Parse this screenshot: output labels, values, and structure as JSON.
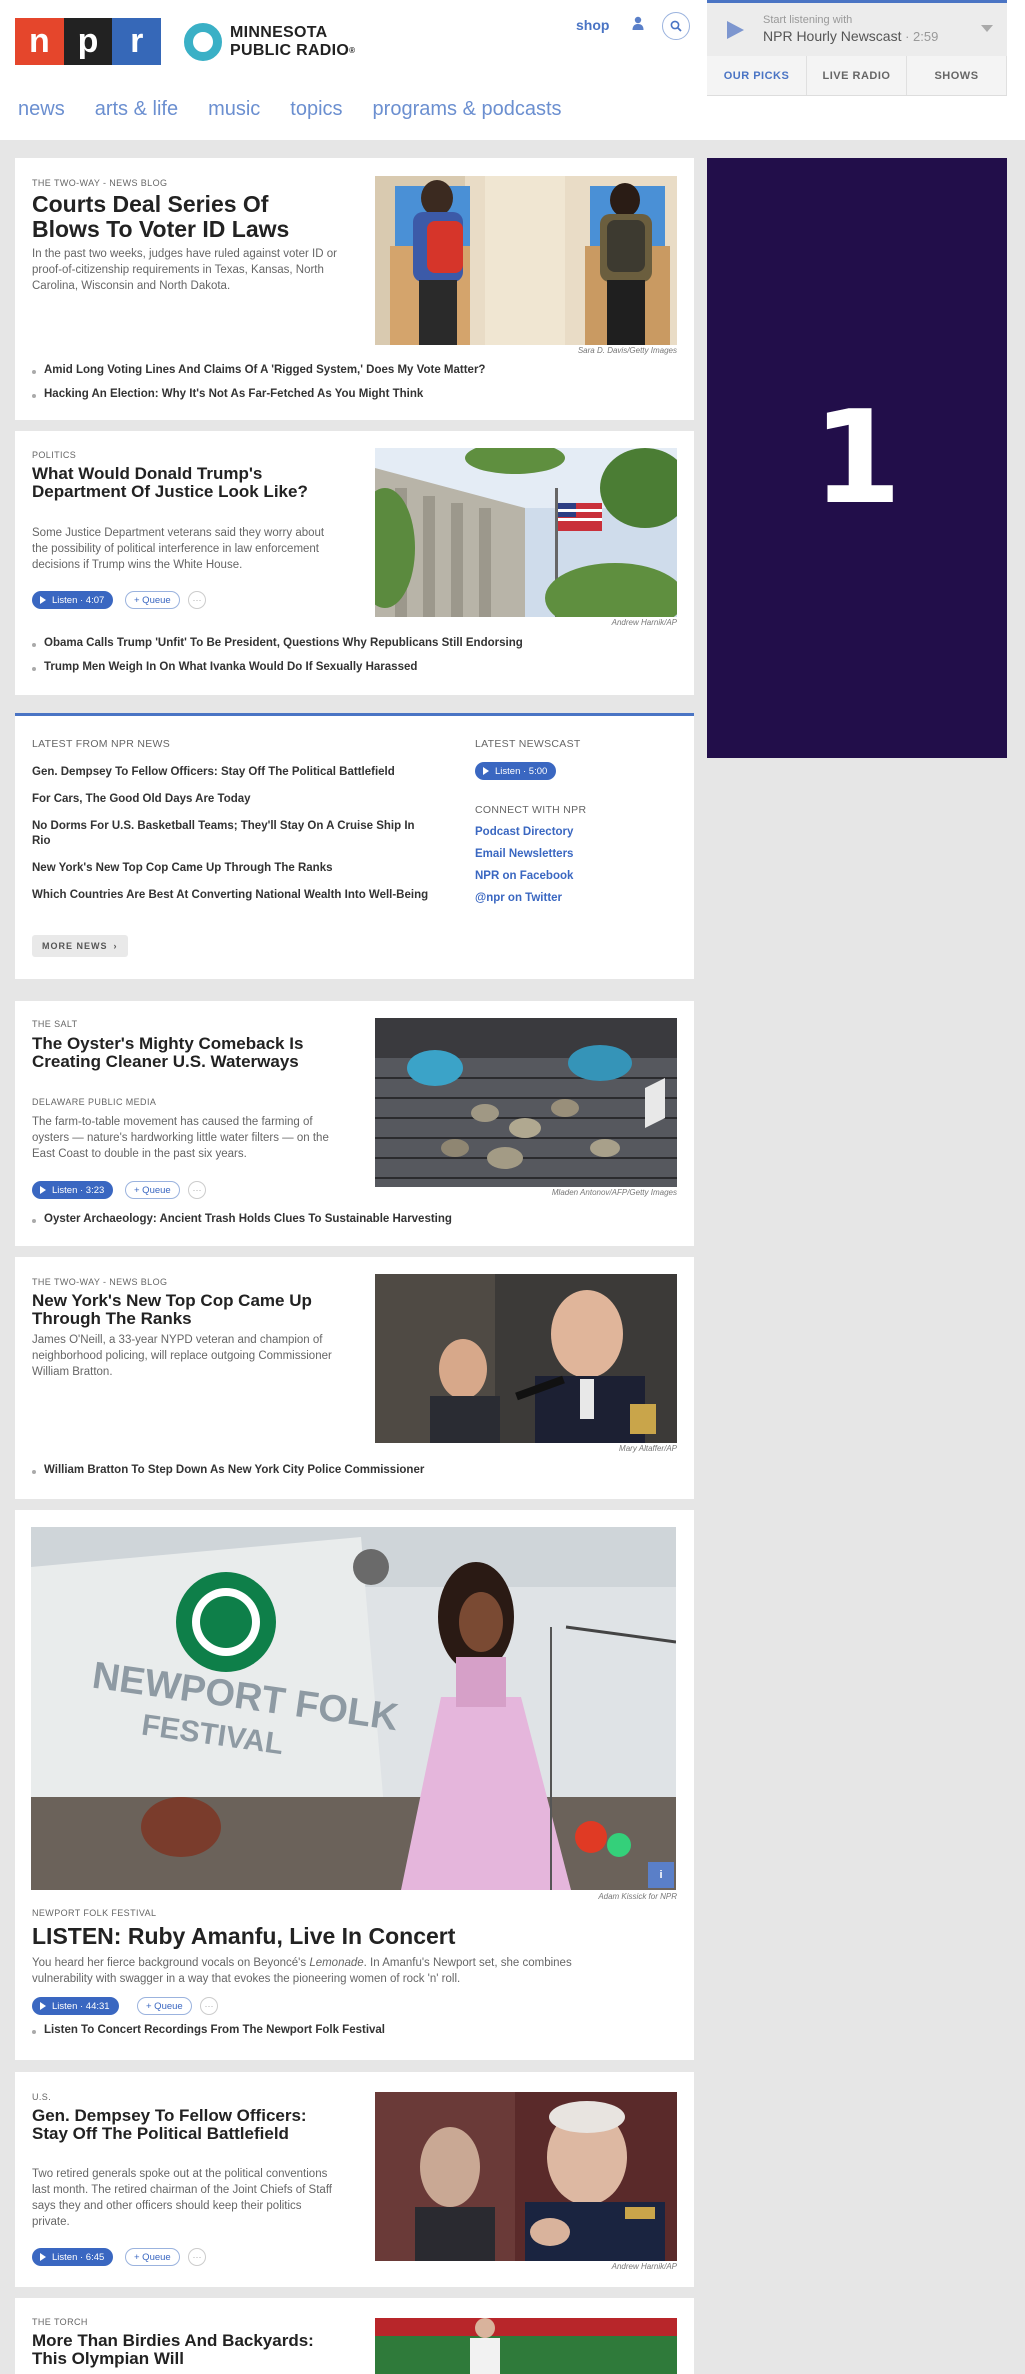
{
  "header": {
    "npr_letters": [
      "n",
      "p",
      "r"
    ],
    "station_line1": "MINNESOTA",
    "station_line2": "PUBLIC RADIO",
    "station_mark": "®",
    "shop": "shop",
    "user_icon": "user-icon",
    "search_icon": "search-icon"
  },
  "player": {
    "start": "Start listening with",
    "program": "NPR Hourly Newscast",
    "duration": " · 2:59",
    "tabs": [
      "OUR PICKS",
      "LIVE RADIO",
      "SHOWS"
    ]
  },
  "nav": [
    "news",
    "arts & life",
    "music",
    "topics",
    "programs & podcasts"
  ],
  "ad": {
    "text": "1"
  },
  "stories": [
    {
      "slug": "THE TWO-WAY - NEWS BLOG",
      "title": "Courts Deal Series Of Blows To Voter ID Laws",
      "teaser": "In the past two weeks, judges have ruled against voter ID or proof-of-citizenship requirements in Texas, Kansas, North Carolina, Wisconsin and North Dakota.",
      "credit": "Sara D. Davis/Getty Images",
      "related": [
        "Amid Long Voting Lines And Claims Of A 'Rigged System,' Does My Vote Matter?",
        "Hacking An Election: Why It's Not As Far-Fetched As You Might Think"
      ]
    },
    {
      "slug": "POLITICS",
      "title": "What Would Donald Trump's Department Of Justice Look Like?",
      "teaser": "Some Justice Department veterans said they worry about the possibility of political interference in law enforcement decisions if Trump wins the White House.",
      "listen": "Listen · 4:07",
      "queue": "+ Queue",
      "credit": "Andrew Harnik/AP",
      "related": [
        "Obama Calls Trump 'Unfit' To Be President, Questions Why Republicans Still Endorsing",
        "Trump Men Weigh In On What Ivanka Would Do If Sexually Harassed"
      ]
    },
    {
      "slug": "THE SALT",
      "title": "The Oyster's Mighty Comeback Is Creating Cleaner U.S. Waterways",
      "source": "DELAWARE PUBLIC MEDIA",
      "teaser": "The farm-to-table movement has caused the farming of oysters — nature's hardworking little water filters — on the East Coast to double in the past six years.",
      "listen": "Listen · 3:23",
      "queue": "+ Queue",
      "credit": "Mladen Antonov/AFP/Getty Images",
      "related": [
        "Oyster Archaeology: Ancient Trash Holds Clues To Sustainable Harvesting"
      ]
    },
    {
      "slug": "THE TWO-WAY - NEWS BLOG",
      "title": "New York's New Top Cop Came Up Through The Ranks",
      "teaser": "James O'Neill, a 33-year NYPD veteran and champion of neighborhood policing, will replace outgoing Commissioner William Bratton.",
      "credit": "Mary Altaffer/AP",
      "related": [
        "William Bratton To Step Down As New York City Police Commissioner"
      ]
    },
    {
      "slug": "NEWPORT FOLK FESTIVAL",
      "title": "LISTEN: Ruby Amanfu, Live In Concert",
      "teaser_pre": "You heard her fierce background vocals on Beyoncé's ",
      "teaser_em": "Lemonade",
      "teaser_post": ". In Amanfu's Newport set, she combines vulnerability with swagger in a way that evokes the pioneering women of rock 'n' roll.",
      "listen": "Listen · 44:31",
      "queue": "+ Queue",
      "credit": "Adam Kissick for NPR",
      "banner_line1": "NEWPORT FOLK",
      "banner_line2": "FESTIVAL",
      "info_icon": "i",
      "related": [
        "Listen To Concert Recordings From The Newport Folk Festival"
      ]
    },
    {
      "slug": "U.S.",
      "title": "Gen. Dempsey To Fellow Officers: Stay Off The Political Battlefield",
      "teaser": "Two retired generals spoke out at the political conventions last month. The retired chairman of the Joint Chiefs of Staff says they and other officers should keep their politics private.",
      "listen": "Listen · 6:45",
      "queue": "+ Queue",
      "credit": "Andrew Harnik/AP"
    },
    {
      "slug": "THE TORCH",
      "title": "More Than Birdies And Backyards: This Olympian Will"
    }
  ],
  "latest": {
    "heading": "LATEST FROM NPR NEWS",
    "items": [
      "Gen. Dempsey To Fellow Officers: Stay Off The Political Battlefield",
      "For Cars, The Good Old Days Are Today",
      "No Dorms For U.S. Basketball Teams; They'll Stay On A Cruise Ship In Rio",
      "New York's New Top Cop Came Up Through The Ranks",
      "Which Countries Are Best At Converting National Wealth Into Well-Being"
    ],
    "more": "MORE NEWS",
    "newscast_heading": "LATEST NEWSCAST",
    "newscast_listen": "Listen · 5:00",
    "connect_heading": "CONNECT WITH NPR",
    "connect": [
      "Podcast Directory",
      "Email Newsletters",
      "NPR on Facebook",
      "@npr on Twitter"
    ]
  },
  "colors": {
    "npr_red": "#e5462c",
    "npr_blue": "#3668b8",
    "accent": "#4a74c4",
    "ad_bg": "#220e4a"
  }
}
